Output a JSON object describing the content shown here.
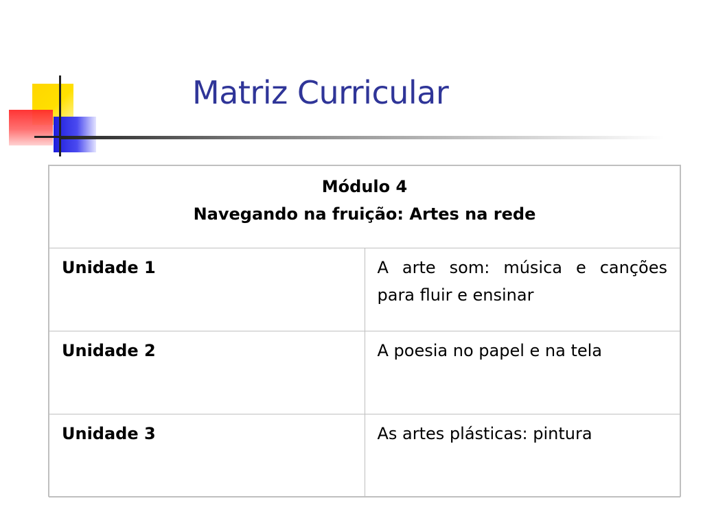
{
  "slide": {
    "title": "Matriz Curricular"
  },
  "table": {
    "header_line1": "Módulo 4",
    "header_line2": "Navegando na fruição: Artes na rede",
    "rows": [
      {
        "unit": "Unidade 1",
        "description": "A arte som: música e canções para fluir e ensinar"
      },
      {
        "unit": "Unidade 2",
        "description": "A poesia no papel e na tela"
      },
      {
        "unit": "Unidade 3",
        "description": "As artes plásticas: pintura"
      }
    ]
  },
  "colors": {
    "title": "#2f3598",
    "deco_yellow": "#ffd600",
    "deco_red": "#ff2a2a",
    "deco_blue": "#1d1ddc"
  }
}
